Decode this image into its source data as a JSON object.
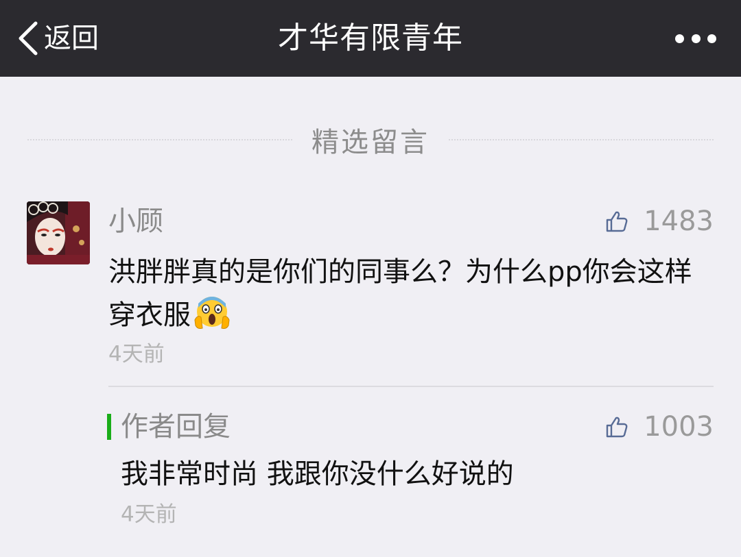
{
  "navbar": {
    "back_label": "返回",
    "title": "才华有限青年",
    "more_icon": "more-dots-icon"
  },
  "section": {
    "title": "精选留言"
  },
  "comment": {
    "author": "小顾",
    "likes": "1483",
    "text": "洪胖胖真的是你们的同事么？为什么pp你会这样穿衣服",
    "emoji": "screaming-face-emoji",
    "time": "4天前"
  },
  "reply": {
    "label": "作者回复",
    "likes": "1003",
    "text": "我非常时尚 我跟你没什么好说的",
    "time": "4天前"
  },
  "colors": {
    "navbar_bg": "#2b2a2f",
    "page_bg": "#f0eff4",
    "reply_accent": "#1aad19",
    "like_icon": "#576b95"
  }
}
